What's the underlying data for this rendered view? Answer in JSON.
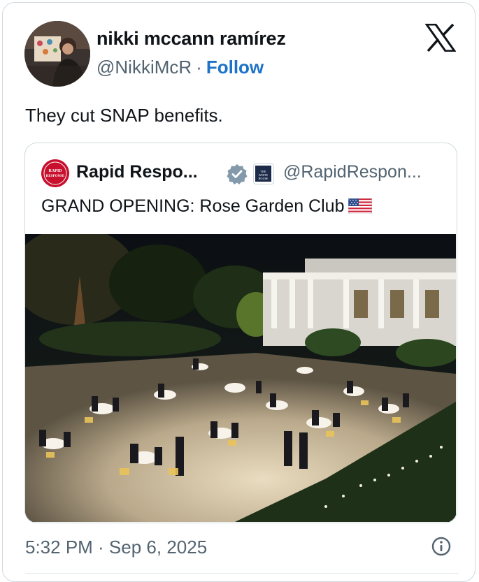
{
  "author": {
    "name": "nikki mccann ramírez",
    "handle": "@NikkiMcR",
    "separator": "·",
    "follow_label": "Follow"
  },
  "tweet": {
    "text": "They cut SNAP benefits.",
    "timestamp": "5:32 PM · Sep 6, 2025"
  },
  "quote": {
    "name": "Rapid Respo...",
    "handle": "@RapidRespon...",
    "text": "GRAND OPENING: Rose Garden Club",
    "avatar_text": "RAPID RESPONSE",
    "badge_text": "THE WHITE HOUSE"
  },
  "colors": {
    "follow": "#1d73c8",
    "verified": "#829aab",
    "secondary_text": "#536471",
    "border": "#cfd9de"
  },
  "icons": {
    "close": "x-logo-icon",
    "verified": "verified-badge-icon",
    "flag": "us-flag-icon",
    "info": "info-icon"
  }
}
